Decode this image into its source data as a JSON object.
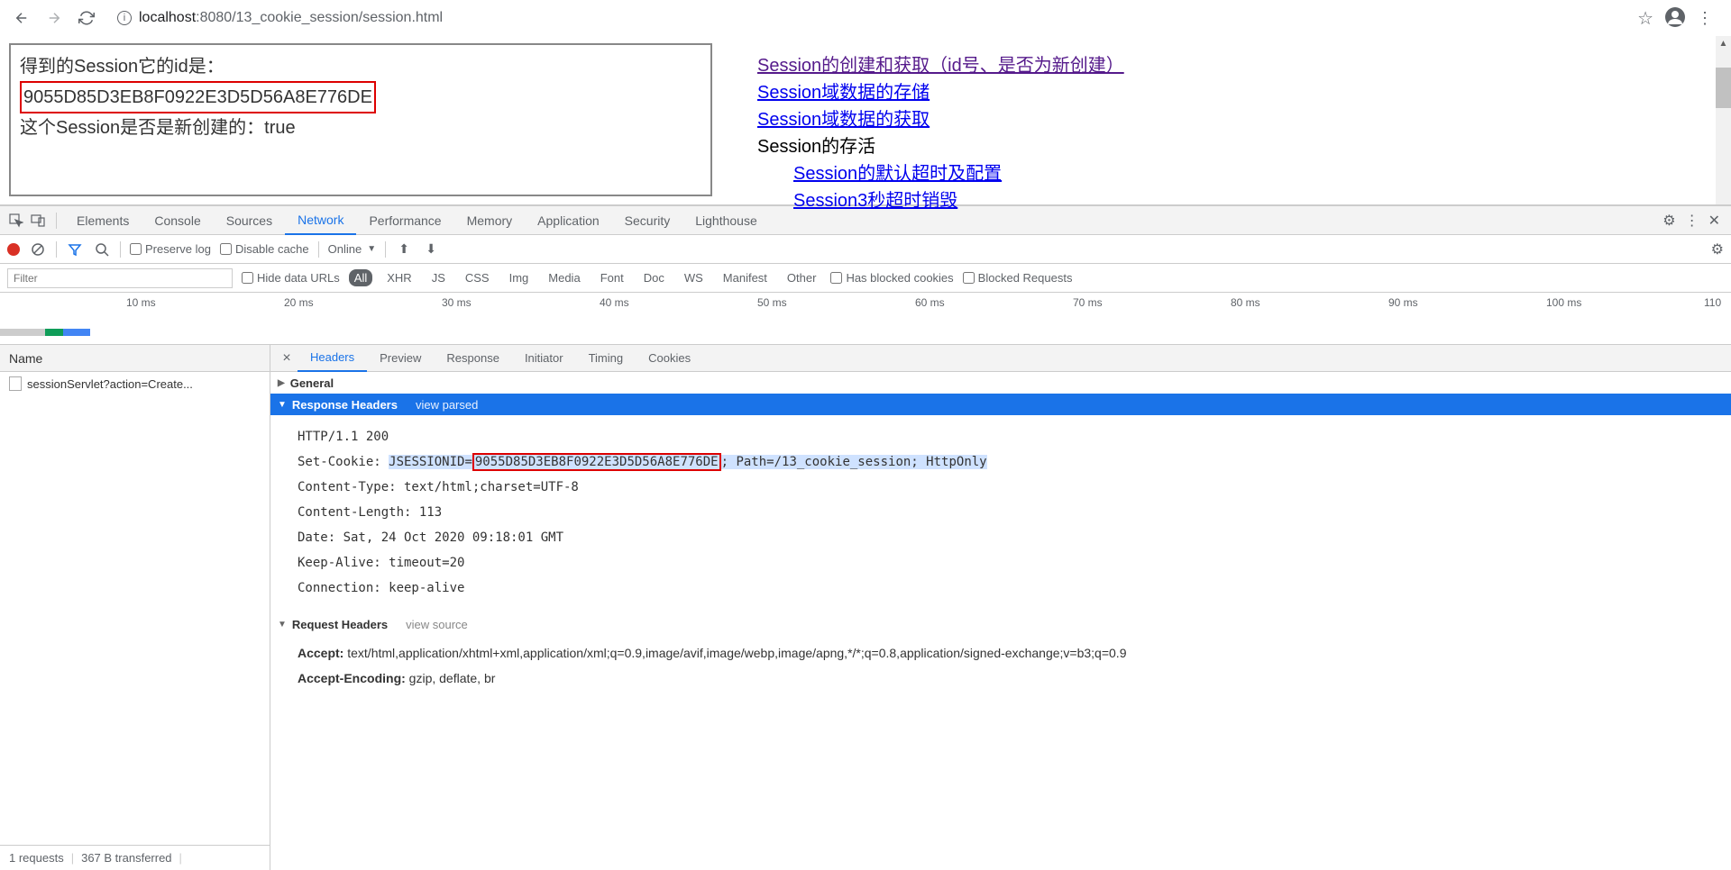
{
  "browser": {
    "url_host": "localhost",
    "url_port": ":8080",
    "url_path": "/13_cookie_session/session.html"
  },
  "page": {
    "left": {
      "line1": "得到的Session它的id是：",
      "session_id": "9055D85D3EB8F0922E3D5D56A8E776DE",
      "line3_prefix": "这个Session是否是新创建的：",
      "line3_value": "true"
    },
    "links": {
      "l1": "Session的创建和获取（id号、是否为新创建）",
      "l2": "Session域数据的存储",
      "l3": "Session域数据的获取",
      "l4": "Session的存活",
      "l5": "Session的默认超时及配置",
      "l6": "Session3秒超时销毁"
    }
  },
  "devtools": {
    "tabs": {
      "elements": "Elements",
      "console": "Console",
      "sources": "Sources",
      "network": "Network",
      "performance": "Performance",
      "memory": "Memory",
      "application": "Application",
      "security": "Security",
      "lighthouse": "Lighthouse"
    },
    "net_toolbar": {
      "preserve": "Preserve log",
      "disable_cache": "Disable cache",
      "online": "Online"
    },
    "filter": {
      "placeholder": "Filter",
      "hide_urls": "Hide data URLs",
      "all": "All",
      "xhr": "XHR",
      "js": "JS",
      "css": "CSS",
      "img": "Img",
      "media": "Media",
      "font": "Font",
      "doc": "Doc",
      "ws": "WS",
      "manifest": "Manifest",
      "other": "Other",
      "blocked_cookies": "Has blocked cookies",
      "blocked_req": "Blocked Requests"
    },
    "timeline": {
      "t1": "10 ms",
      "t2": "20 ms",
      "t3": "30 ms",
      "t4": "40 ms",
      "t5": "50 ms",
      "t6": "60 ms",
      "t7": "70 ms",
      "t8": "80 ms",
      "t9": "90 ms",
      "t10": "100 ms",
      "t11": "110"
    },
    "list": {
      "header": "Name",
      "item1": "sessionServlet?action=Create...",
      "footer_req": "1 requests",
      "footer_xfer": "367 B transferred"
    },
    "detail": {
      "tabs": {
        "headers": "Headers",
        "preview": "Preview",
        "response": "Response",
        "initiator": "Initiator",
        "timing": "Timing",
        "cookies": "Cookies"
      },
      "general": "General",
      "resp_hdr": "Response Headers",
      "view_parsed": "view parsed",
      "req_hdr": "Request Headers",
      "view_source": "view source",
      "lines": {
        "l1": "HTTP/1.1 200",
        "l2_key": "Set-Cookie: ",
        "l2_a": "JSESSIONID=",
        "l2_b": "9055D85D3EB8F0922E3D5D56A8E776DE",
        "l2_c": "; Path=/13_cookie_session; HttpOnly",
        "l3": "Content-Type: text/html;charset=UTF-8",
        "l4": "Content-Length: 113",
        "l5": "Date: Sat, 24 Oct 2020 09:18:01 GMT",
        "l6": "Keep-Alive: timeout=20",
        "l7": "Connection: keep-alive"
      },
      "req": {
        "accept_k": "Accept: ",
        "accept_v": "text/html,application/xhtml+xml,application/xml;q=0.9,image/avif,image/webp,image/apng,*/*;q=0.8,application/signed-exchange;v=b3;q=0.9",
        "enc_k": "Accept-Encoding: ",
        "enc_v": "gzip, deflate, br"
      }
    }
  }
}
